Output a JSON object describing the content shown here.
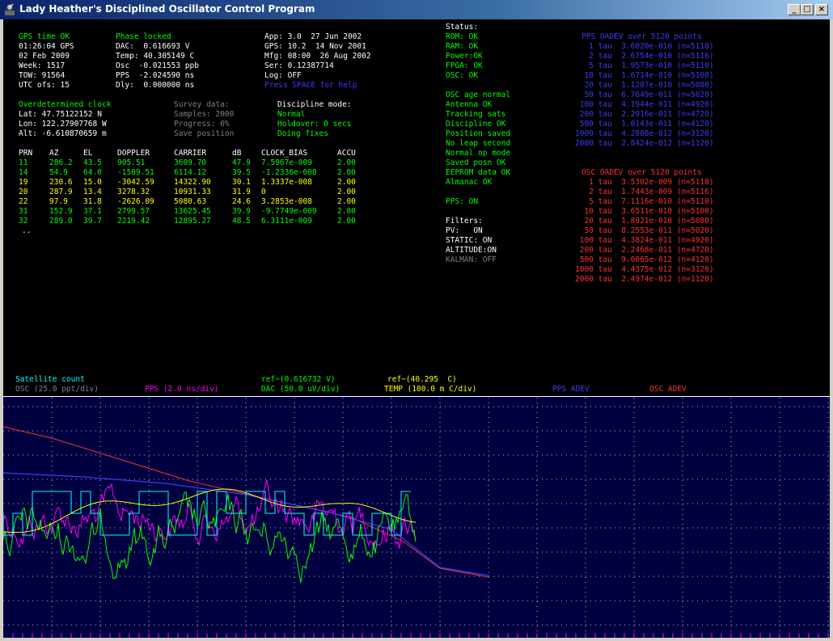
{
  "window": {
    "title": "Lady Heather's Disciplined Oscillator Control Program",
    "controls": {
      "minimize": "_",
      "maximize": "□",
      "close": "×"
    }
  },
  "gps": {
    "status": "GPS time OK",
    "time": "01:26:04 GPS",
    "date": "02 Feb 2009",
    "week": "Week: 1517",
    "tow": "TOW: 91564",
    "utc": "UTC ofs: 15"
  },
  "phase": {
    "status": "Phase locked",
    "dac": "DAC:  0.616693 V",
    "temp": "Temp: 40.305149 C",
    "osc": "Osc  -0.021553 ppb",
    "pps": "PPS  -2.024590 ns",
    "dly": "Dly:  0.000000 ns"
  },
  "app": {
    "app": "App: 3.0  27 Jun 2002",
    "gps": "GPS: 10.2  14 Nov 2001",
    "mfg": "Mfg: 08:00  26 Aug 2002",
    "ser": "Ser: 0.12387714",
    "log": "Log: OFF",
    "help": "Press SPACE for help"
  },
  "position": {
    "mode": "Overdetermined clock",
    "lat": "Lat: 47.75122152 N",
    "lon": "Lon: 122.27907768 W",
    "alt": "Alt: -6.610870659 m"
  },
  "survey": {
    "title": "Survey data:",
    "samples": "Samples: 2000",
    "progress": "Progress: 0%",
    "save": "Save position"
  },
  "discipline": {
    "title": "Discipline mode:",
    "mode": "Normal",
    "holdover": "Holdover: 0 secs",
    "fixes": "Doing fixes"
  },
  "sat_table": {
    "headers": [
      "PRN",
      "AZ",
      "EL",
      "DOPPLER",
      "CARRIER",
      "dB",
      "CLOCK_BIAS",
      "ACCU"
    ],
    "rows": [
      {
        "color": "#00ff00",
        "cells": [
          "11",
          "286.2",
          "43.5",
          "905.51",
          "3609.70",
          "47.9",
          "7.5967e-009",
          "2.00"
        ]
      },
      {
        "color": "#00ff00",
        "cells": [
          "14",
          "54.9",
          "64.0",
          "-1509.51",
          "6114.12",
          "39.5",
          "-1.2336e-008",
          "2.00"
        ]
      },
      {
        "color": "#ffff00",
        "cells": [
          "19",
          "230.6",
          "15.0",
          "-3042.59",
          "14322.90",
          "30.1",
          "1.3337e-008",
          "2.00"
        ]
      },
      {
        "color": "#ffff00",
        "cells": [
          "20",
          "287.9",
          "13.4",
          "3278.32",
          "10931.33",
          "31.9",
          "0",
          "2.00"
        ]
      },
      {
        "color": "#ffff00",
        "cells": [
          "22",
          "97.9",
          "31.8",
          "-2626.09",
          "5080.63",
          "24.6",
          "3.2853e-008",
          "2.00"
        ]
      },
      {
        "color": "#00ff00",
        "cells": [
          "31",
          "152.9",
          "37.1",
          "2799.57",
          "13625.45",
          "39.9",
          "-9.7749e-009",
          "2.00"
        ]
      },
      {
        "color": "#00ff00",
        "cells": [
          "32",
          "289.0",
          "39.7",
          "2219.42",
          "12895.27",
          "48.5",
          "6.3111e-009",
          "2.00"
        ]
      }
    ],
    "more": ".."
  },
  "status": {
    "title": "Status:",
    "items": [
      {
        "text": "ROM: OK",
        "color": "#00ff00"
      },
      {
        "text": "RAM: OK",
        "color": "#00ff00"
      },
      {
        "text": "Power:OK",
        "color": "#00ff00"
      },
      {
        "text": "FPGA: OK",
        "color": "#00ff00"
      },
      {
        "text": "OSC: OK",
        "color": "#00ff00"
      },
      {
        "text": "",
        "color": "#00ff00"
      },
      {
        "text": "OSC age normal",
        "color": "#00ff00"
      },
      {
        "text": "Antenna OK",
        "color": "#00ff00"
      },
      {
        "text": "Tracking sats",
        "color": "#00ff00"
      },
      {
        "text": "Discipline OK",
        "color": "#00ff00"
      },
      {
        "text": "Position saved",
        "color": "#00ff00"
      },
      {
        "text": "No leap second",
        "color": "#00ff00"
      },
      {
        "text": "Normal op mode",
        "color": "#00ff00"
      },
      {
        "text": "Saved posn OK",
        "color": "#00ff00"
      },
      {
        "text": "EEPROM data OK",
        "color": "#00ff00"
      },
      {
        "text": "Almanac OK",
        "color": "#00ff00"
      },
      {
        "text": "",
        "color": "#00ff00"
      },
      {
        "text": "PPS: ON",
        "color": "#00ff00"
      }
    ]
  },
  "filters": {
    "title": "Filters:",
    "pv": "PV:   ON",
    "static": "STATIC: ON",
    "altitude": "ALTITUDE:ON",
    "kalman": "KALMAN: OFF"
  },
  "pps_adev": {
    "title": "PPS OADEV over 5120 points",
    "rows": [
      "   1 tau  3.6020e-010 (n=5118)",
      "   2 tau  2.6754e-010 (n=5116)",
      "   5 tau  1.9573e-010 (n=5110)",
      "  10 tau  1.6714e-010 (n=5100)",
      "  20 tau  1.1287e-010 (n=5080)",
      "  50 tau  6.7649e-011 (n=5020)",
      " 100 tau  4.1944e-011 (n=4920)",
      " 200 tau  2.2916e-011 (n=4720)",
      " 500 tau  1.0143e-011 (n=4120)",
      "1000 tau  4.2808e-012 (n=3120)",
      "2000 tau  2.8424e-012 (n=1120)"
    ]
  },
  "osc_adev": {
    "title": "OSC OADEV over 5120 points",
    "rows": [
      "   1 tau  3.5302e-009 (n=5118)",
      "   2 tau  1.7443e-009 (n=5116)",
      "   5 tau  7.1116e-010 (n=5110)",
      "  10 tau  3.6511e-010 (n=5100)",
      "  20 tau  1.8921e-010 (n=5080)",
      "  50 tau  8.2553e-011 (n=5020)",
      " 100 tau  4.3824e-011 (n=4920)",
      " 200 tau  2.2468e-011 (n=4720)",
      " 500 tau  9.0065e-012 (n=4120)",
      "1000 tau  4.4375e-012 (n=3120)",
      "2000 tau  2.4974e-012 (n=1120)"
    ]
  },
  "legend": {
    "sat_count": "Satellite count",
    "osc": "OSC (25.0 ppt/div)",
    "pps": "PPS (2.0 ns/div)",
    "dac_ref": "ref~(0.616732 V)",
    "dac": "DAC (50.0 uV/div)",
    "temp_ref": "ref~(40.295  C)",
    "temp": "TEMP (100.0 m C/div)",
    "pps_adev": "PPS ADEV",
    "osc_adev": "OSC ADEV"
  },
  "colors": {
    "sat_count": "#00ffff",
    "osc": "#ff3030",
    "pps": "#ff00ff",
    "dac": "#00ff00",
    "temp": "#ffff00",
    "pps_adev": "#3c3cff",
    "osc_adev": "#ff3030",
    "grid_bg": "#000040",
    "grid_dot": "#b8b8b8"
  }
}
